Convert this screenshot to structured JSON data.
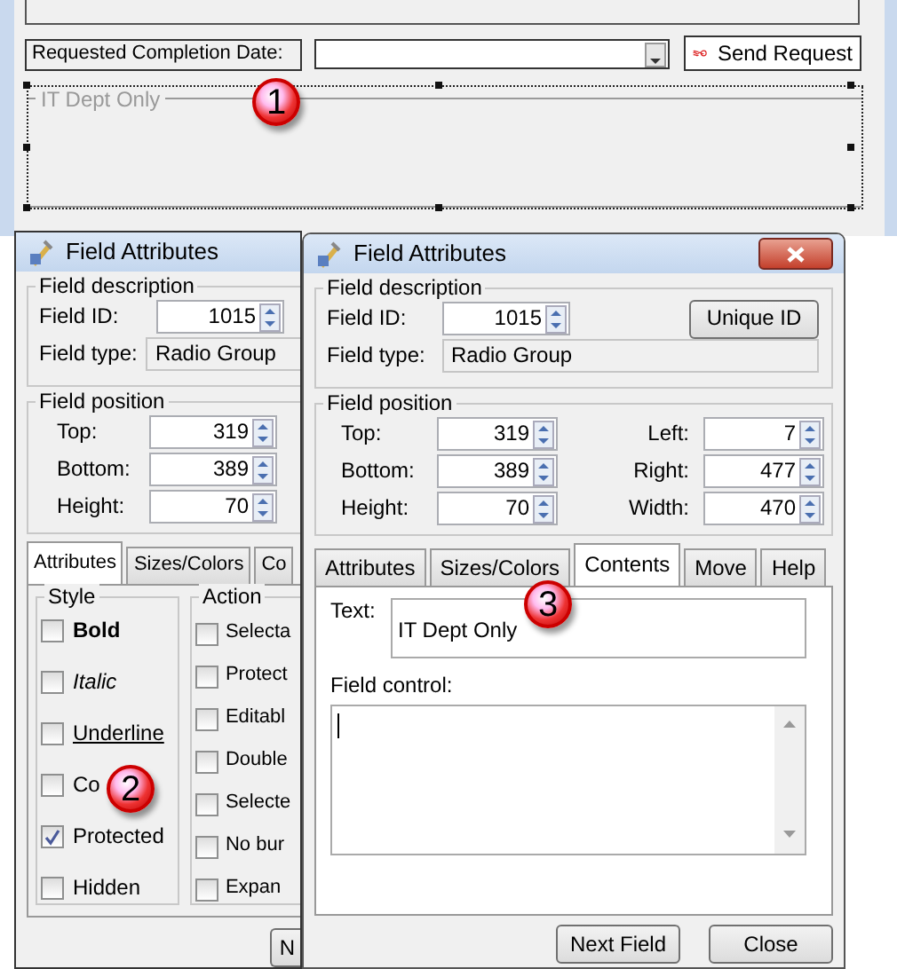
{
  "form": {
    "completion_label": "Requested Completion Date:",
    "send_button": "Send Request",
    "group_title": "IT Dept Only",
    "callout": "1"
  },
  "back_dialog": {
    "title": "Field Attributes",
    "description_title": "Field description",
    "field_id_label": "Field ID:",
    "field_id": "1015",
    "field_type_label": "Field type:",
    "field_type": "Radio Group",
    "position_title": "Field position",
    "position": [
      {
        "label": "Top:",
        "value": "319"
      },
      {
        "label": "Bottom:",
        "value": "389"
      },
      {
        "label": "Height:",
        "value": "70"
      }
    ],
    "tabs": [
      {
        "label": "Attributes",
        "selected": true
      },
      {
        "label": "Sizes/Colors",
        "selected": false
      },
      {
        "label": "Co",
        "selected": false
      }
    ],
    "style_title": "Style",
    "style_options": [
      {
        "label": "Bold",
        "kind": "bold",
        "checked": false
      },
      {
        "label": "Italic",
        "kind": "italic",
        "checked": false
      },
      {
        "label": "Underline",
        "kind": "underline",
        "checked": false
      },
      {
        "label": "Co",
        "kind": "plain",
        "checked": false
      },
      {
        "label": "Protected",
        "kind": "plain",
        "checked": true
      },
      {
        "label": "Hidden",
        "kind": "plain",
        "checked": false
      }
    ],
    "action_title": "Action",
    "action_options": [
      {
        "label": "Selecta",
        "checked": false
      },
      {
        "label": "Protect",
        "checked": false
      },
      {
        "label": "Editabl",
        "checked": false
      },
      {
        "label": "Double",
        "checked": false
      },
      {
        "label": "Selecte",
        "checked": false
      },
      {
        "label": "No bur",
        "checked": false
      },
      {
        "label": "Expan",
        "checked": false
      }
    ],
    "callout": "2",
    "button": "N"
  },
  "front_dialog": {
    "title": "Field Attributes",
    "description_title": "Field description",
    "field_id_label": "Field ID:",
    "field_id": "1015",
    "unique_id_button": "Unique ID",
    "field_type_label": "Field type:",
    "field_type": "Radio Group",
    "position_title": "Field position",
    "position_left": [
      {
        "label": "Top:",
        "value": "319"
      },
      {
        "label": "Bottom:",
        "value": "389"
      },
      {
        "label": "Height:",
        "value": "70"
      }
    ],
    "position_right": [
      {
        "label": "Left:",
        "value": "7"
      },
      {
        "label": "Right:",
        "value": "477"
      },
      {
        "label": "Width:",
        "value": "470"
      }
    ],
    "tabs": [
      {
        "label": "Attributes",
        "selected": false
      },
      {
        "label": "Sizes/Colors",
        "selected": false
      },
      {
        "label": "Contents",
        "selected": true
      },
      {
        "label": "Move",
        "selected": false
      },
      {
        "label": "Help",
        "selected": false
      }
    ],
    "text_label": "Text:",
    "text_value": "IT Dept Only",
    "callout": "3",
    "field_control_label": "Field control:",
    "buttons": [
      "Next Field",
      "Close"
    ]
  }
}
